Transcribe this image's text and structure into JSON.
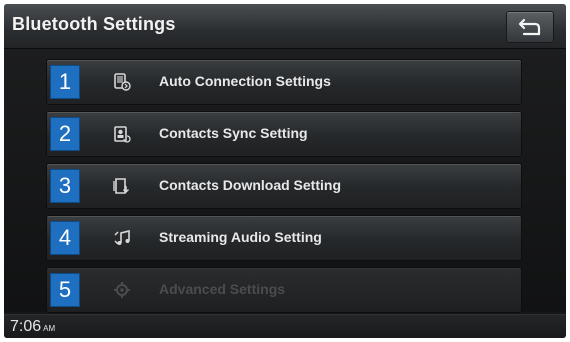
{
  "header": {
    "title": "Bluetooth Settings",
    "back_icon": "back-arrow-icon"
  },
  "menu": {
    "items": [
      {
        "number": "1",
        "label": "Auto Connection Settings",
        "icon": "auto-connection-icon",
        "enabled": true
      },
      {
        "number": "2",
        "label": "Contacts Sync Setting",
        "icon": "contacts-sync-icon",
        "enabled": true
      },
      {
        "number": "3",
        "label": "Contacts Download Setting",
        "icon": "contacts-download-icon",
        "enabled": true
      },
      {
        "number": "4",
        "label": "Streaming Audio Setting",
        "icon": "streaming-audio-icon",
        "enabled": true
      },
      {
        "number": "5",
        "label": "Advanced Settings",
        "icon": "advanced-settings-icon",
        "enabled": false
      }
    ]
  },
  "status": {
    "time": "7:06",
    "ampm": "AM"
  }
}
